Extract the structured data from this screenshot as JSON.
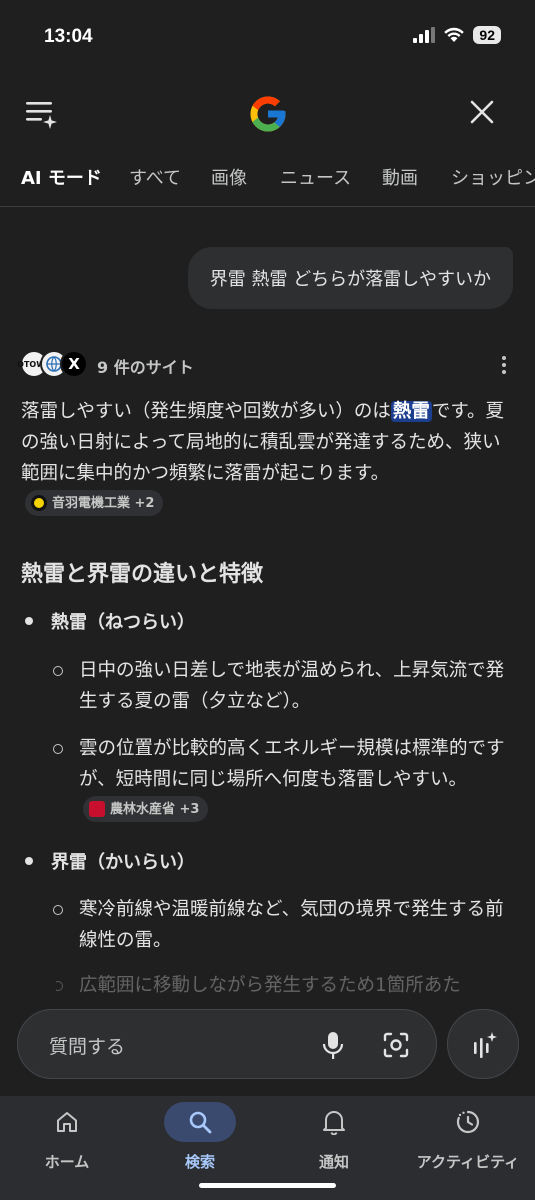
{
  "status_bar": {
    "time": "13:04",
    "battery": "92"
  },
  "header": {
    "logo_icon": "google-g-icon"
  },
  "tabs": [
    {
      "label": "AI モード",
      "active": true
    },
    {
      "label": "すべて"
    },
    {
      "label": "画像"
    },
    {
      "label": "ニュース"
    },
    {
      "label": "動画"
    },
    {
      "label": "ショッピング"
    }
  ],
  "query": "界雷 熱雷 どちらが落雷しやすいか",
  "sources": {
    "label": "9 件のサイト",
    "favicons": [
      "OTOWA",
      "globe",
      "X"
    ]
  },
  "answer": {
    "p1_before": "落雷しやすい（発生頻度や回数が多い）のは",
    "p1_highlight": "熱雷",
    "p1_after": "です。夏の強い日射によって局地的に積乱雲が発達するため、狭い範囲に集中的かつ頻繁に落雷が起こります。",
    "chip1": "音羽電機工業 +2"
  },
  "section": {
    "title": "熱雷と界雷の違いと特徴",
    "items": [
      {
        "label": "熱雷（ねつらい）",
        "subs": [
          "日中の強い日差しで地表が温められ、上昇気流で発生する夏の雷（夕立など）。",
          "雲の位置が比較的高くエネルギー規模は標準的ですが、短時間に同じ場所へ何度も落雷しやすい。"
        ],
        "chip": "農林水産省 +3"
      },
      {
        "label": "界雷（かいらい）",
        "subs": [
          "寒冷前線や温暖前線など、気団の境界で発生する前線性の雷。",
          "広範囲に移動しながら発生するため1箇所あた"
        ]
      }
    ]
  },
  "ask": {
    "placeholder": "質問する"
  },
  "bottom_nav": [
    {
      "label": "ホーム",
      "icon": "home-icon"
    },
    {
      "label": "検索",
      "icon": "search-icon",
      "active": true
    },
    {
      "label": "通知",
      "icon": "bell-icon"
    },
    {
      "label": "アクティビティ",
      "icon": "activity-icon"
    }
  ]
}
